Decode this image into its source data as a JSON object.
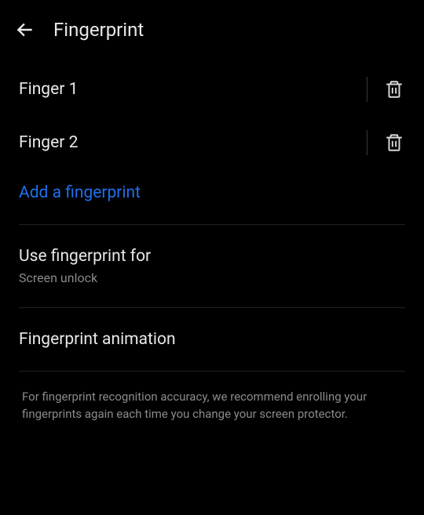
{
  "header": {
    "title": "Fingerprint"
  },
  "fingerprints": {
    "items": [
      {
        "label": "Finger 1"
      },
      {
        "label": "Finger 2"
      }
    ],
    "add_label": "Add a fingerprint"
  },
  "use_for": {
    "title": "Use fingerprint for",
    "subtitle": "Screen unlock"
  },
  "animation": {
    "title": "Fingerprint animation"
  },
  "note": {
    "text": "For fingerprint recognition accuracy, we recommend enrolling your fingerprints again each time you change your screen protector."
  }
}
